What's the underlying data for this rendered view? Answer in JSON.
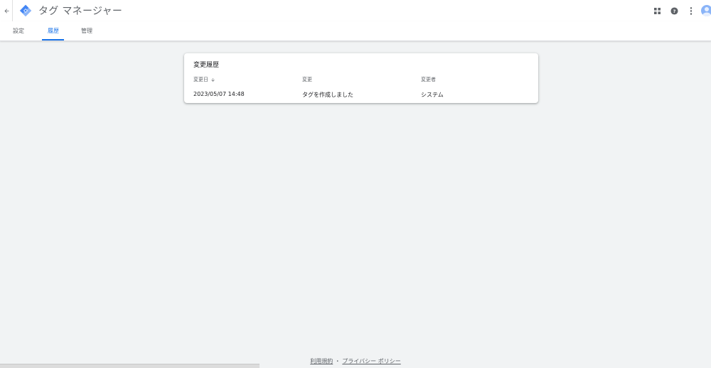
{
  "header": {
    "app_title": "タグ マネージャー"
  },
  "tabs": [
    {
      "label": "設定"
    },
    {
      "label": "履歴"
    },
    {
      "label": "管理"
    }
  ],
  "active_tab": "履歴",
  "card": {
    "title": "変更履歴",
    "columns": [
      "変更日",
      "変更",
      "変更者"
    ],
    "rows": [
      {
        "date": "2023/05/07 14:48",
        "change": "タグを作成しました",
        "user": "システム"
      }
    ]
  },
  "footer": {
    "terms": "利用規約",
    "separator": "・",
    "privacy": "プライバシー ポリシー"
  },
  "colors": {
    "accent": "#1a73e8",
    "background": "#f1f3f4"
  }
}
